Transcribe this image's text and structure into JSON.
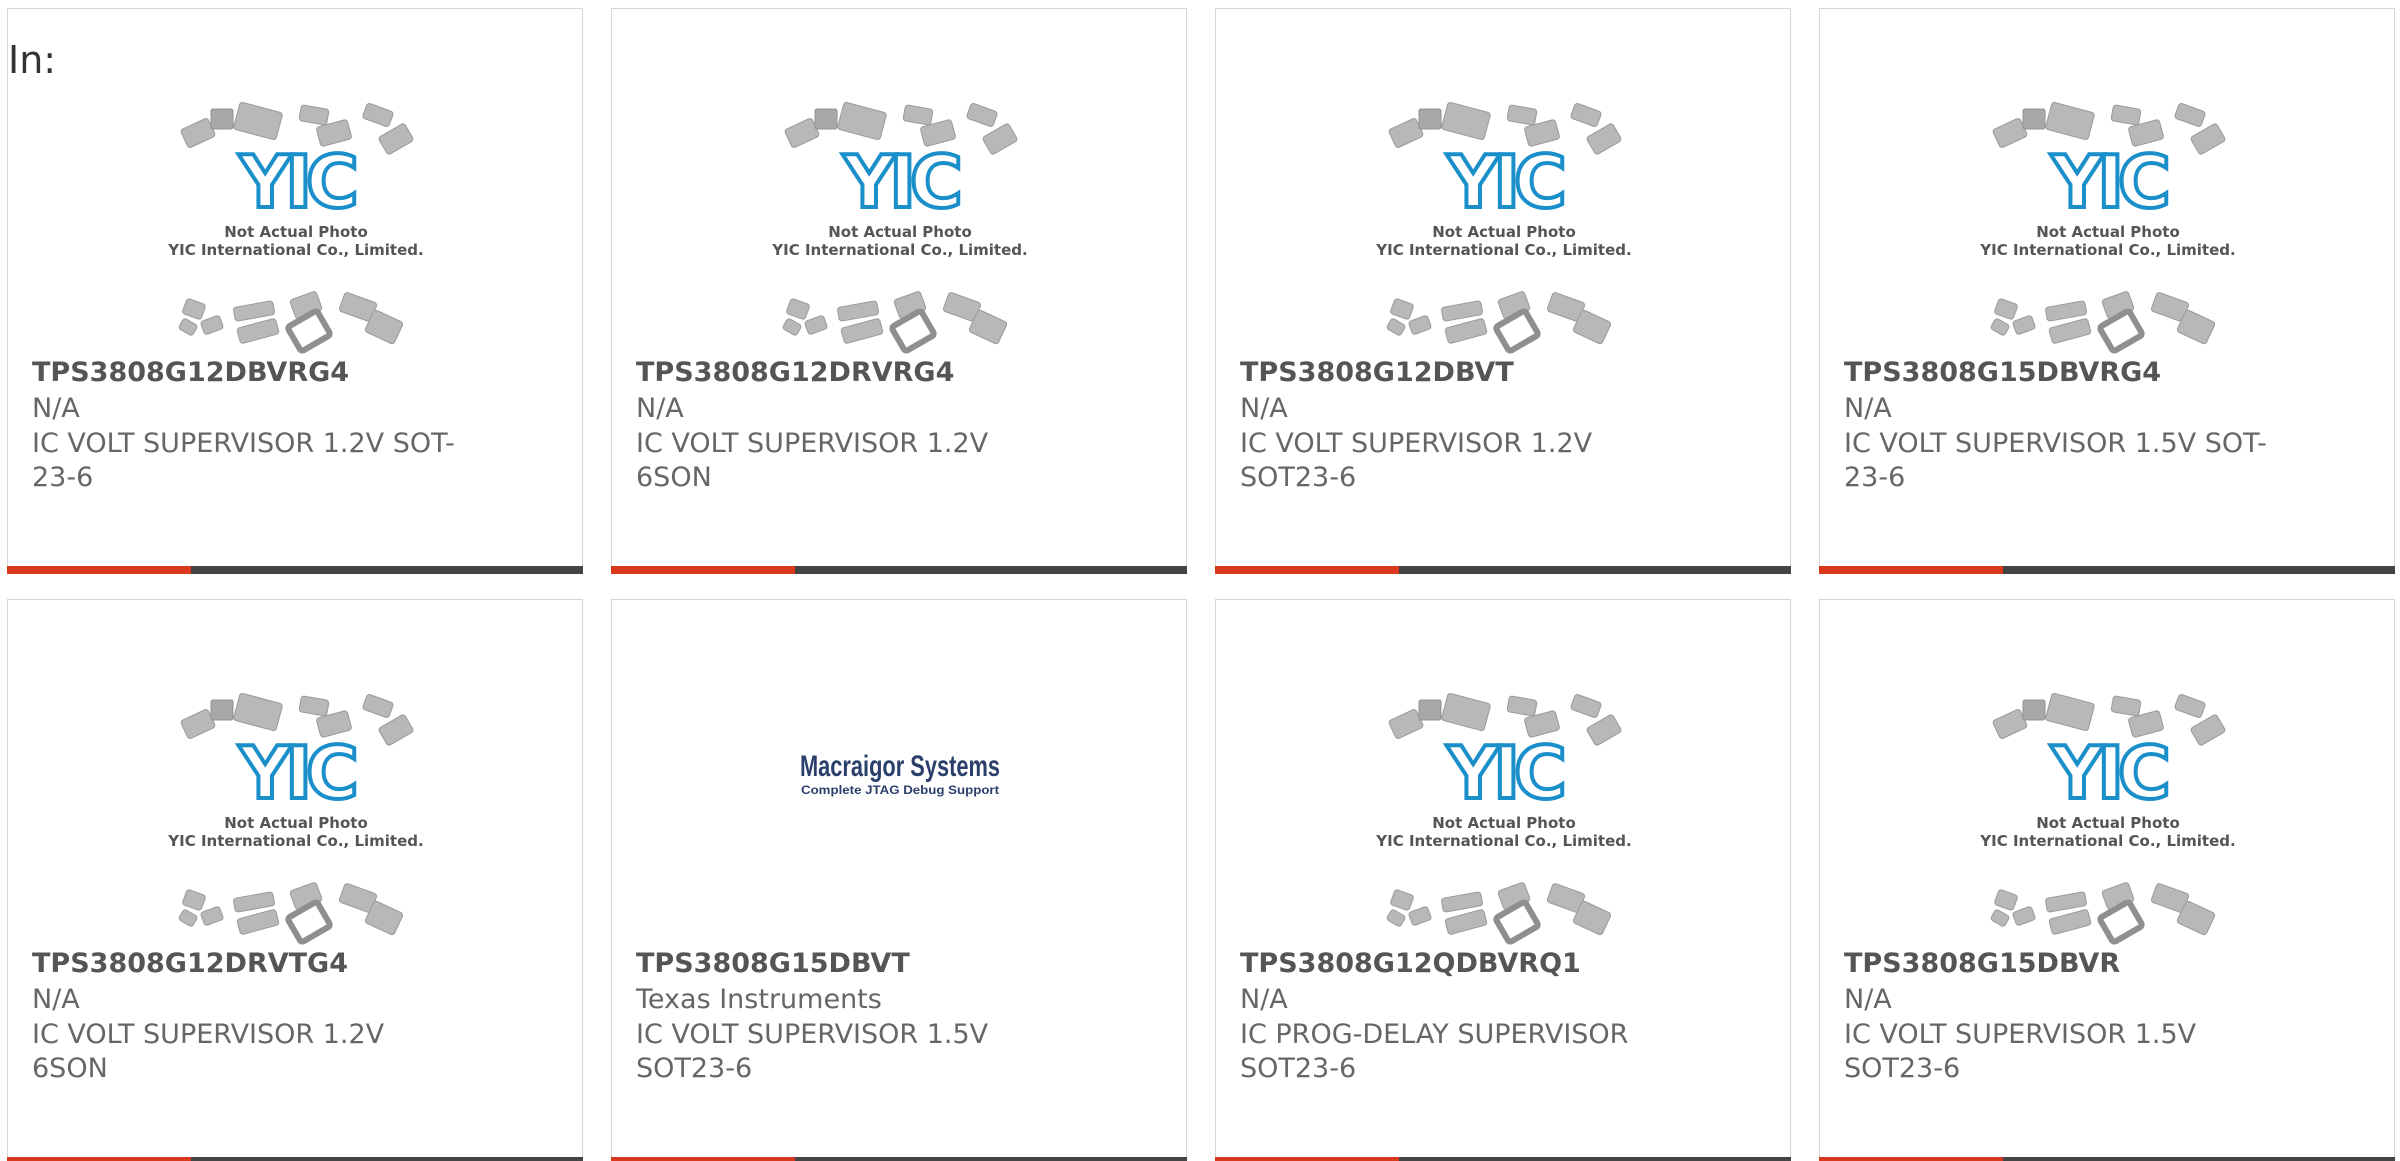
{
  "filter": {
    "label": "In:"
  },
  "cards": [
    {
      "part_number": "TPS3808G12DBVRG4",
      "manufacturer": "N/A",
      "description": "IC VOLT SUPERVISOR 1.2V SOT-23-6",
      "image": "yic-placeholder"
    },
    {
      "part_number": "TPS3808G12DRVRG4",
      "manufacturer": "N/A",
      "description": "IC VOLT SUPERVISOR 1.2V 6SON",
      "image": "yic-placeholder"
    },
    {
      "part_number": "TPS3808G12DBVT",
      "manufacturer": "N/A",
      "description": "IC VOLT SUPERVISOR 1.2V SOT23-6",
      "image": "yic-placeholder"
    },
    {
      "part_number": "TPS3808G15DBVRG4",
      "manufacturer": "N/A",
      "description": "IC VOLT SUPERVISOR 1.5V SOT-23-6",
      "image": "yic-placeholder"
    },
    {
      "part_number": "TPS3808G12DRVTG4",
      "manufacturer": "N/A",
      "description": "IC VOLT SUPERVISOR 1.2V 6SON",
      "image": "yic-placeholder"
    },
    {
      "part_number": "TPS3808G15DBVT",
      "manufacturer": "Texas Instruments",
      "description": "IC VOLT SUPERVISOR 1.5V SOT23-6",
      "image": "macraigor-logo"
    },
    {
      "part_number": "TPS3808G12QDBVRQ1",
      "manufacturer": "N/A",
      "description": "IC PROG-DELAY SUPERVISOR SOT23-6",
      "image": "yic-placeholder"
    },
    {
      "part_number": "TPS3808G15DBVR",
      "manufacturer": "N/A",
      "description": "IC VOLT SUPERVISOR 1.5V SOT23-6",
      "image": "yic-placeholder"
    }
  ],
  "placeholder": {
    "caption_line1": "Not Actual Photo",
    "caption_line2": "YIC International Co., Limited.",
    "logo_text": "YIC"
  },
  "macraigor": {
    "name": "Macraigor Systems",
    "tagline": "Complete JTAG Debug Support"
  },
  "colors": {
    "accent": "#d9381e",
    "bar": "#444444",
    "logo_blue": "#1a8fc9",
    "text": "#666666"
  }
}
